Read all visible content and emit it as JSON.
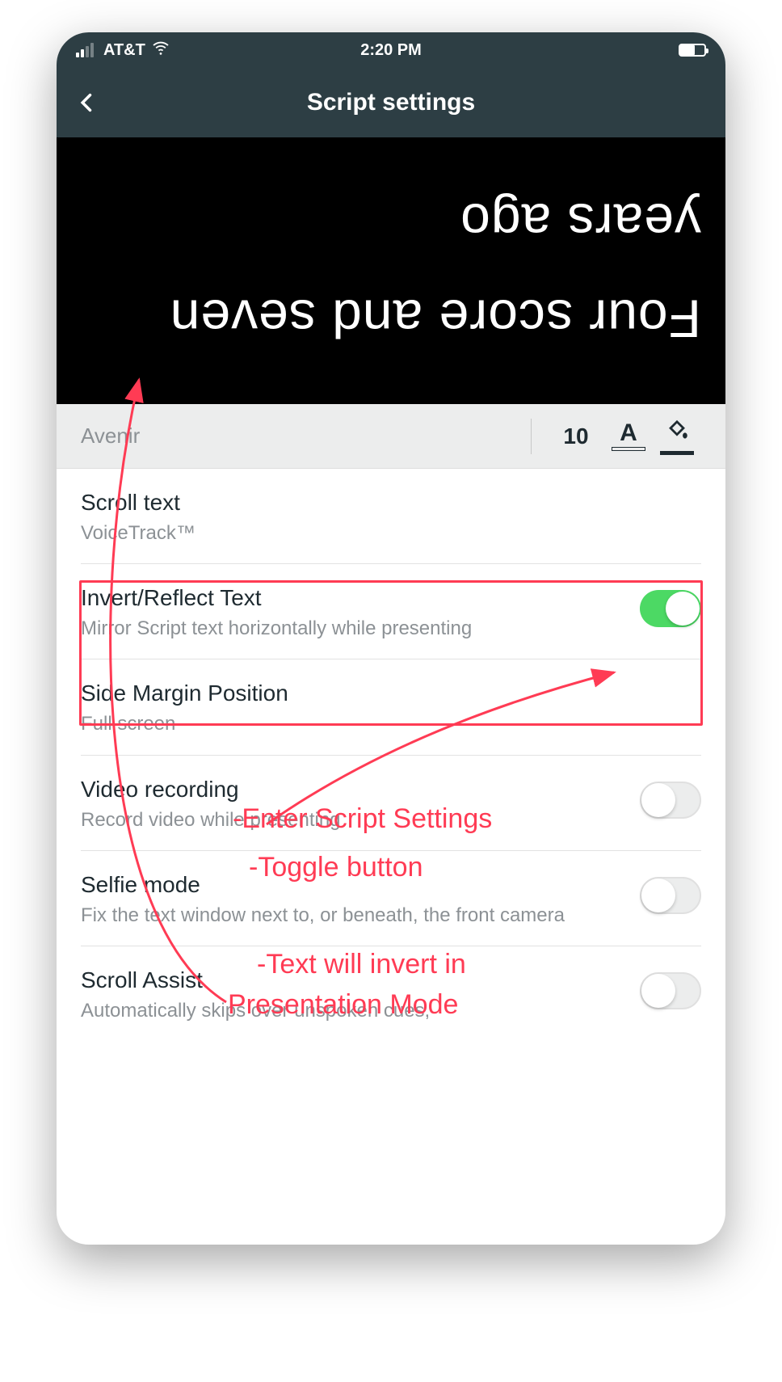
{
  "status": {
    "carrier": "AT&T",
    "time": "2:20 PM"
  },
  "nav": {
    "title": "Script settings"
  },
  "preview": {
    "text": "Four score and seven years ago"
  },
  "format_bar": {
    "font_name": "Avenir",
    "font_size": "10"
  },
  "rows": {
    "scroll_text": {
      "title": "Scroll text",
      "sub": "VoiceTrack™"
    },
    "invert": {
      "title": "Invert/Reflect Text",
      "sub": "Mirror Script text horizontally while presenting",
      "toggle": true
    },
    "side_margin": {
      "title": "Side Margin Position",
      "sub": "Full screen"
    },
    "video_recording": {
      "title": "Video recording",
      "sub": "Record video while presenting",
      "toggle": false
    },
    "selfie_mode": {
      "title": "Selfie mode",
      "sub": "Fix the text window next to, or beneath, the front camera",
      "toggle": false
    },
    "scroll_assist": {
      "title": "Scroll Assist",
      "sub": "Automatically skips over unspoken cues,"
    }
  },
  "annotations": {
    "line1": "-Enter Script Settings",
    "line2": "-Toggle button",
    "line3": "-Text will invert in",
    "line4": "Presentation Mode"
  }
}
